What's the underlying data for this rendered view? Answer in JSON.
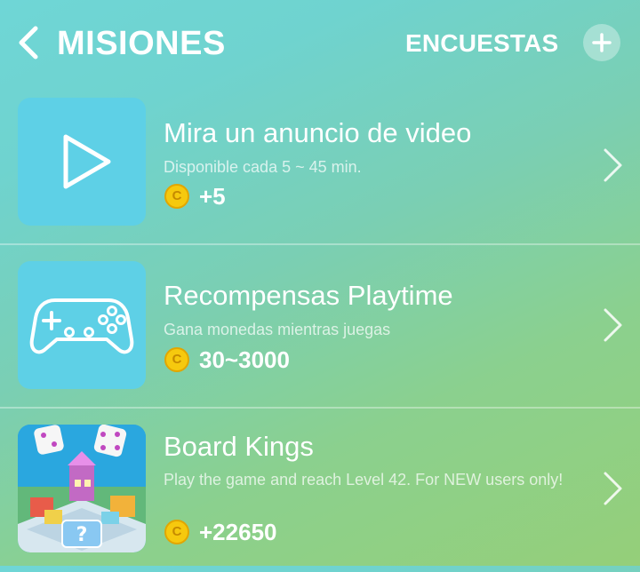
{
  "header": {
    "title": "MISIONES",
    "surveys_label": "ENCUESTAS",
    "back_icon": "chevron-left-icon",
    "add_icon": "plus-icon"
  },
  "missions": [
    {
      "title": "Mira un anuncio de video",
      "description": "Disponible cada 5 ~ 45 min.",
      "reward": "+5",
      "coin_symbol": "C",
      "icon": "play-icon"
    },
    {
      "title": "Recompensas Playtime",
      "description": "Gana monedas mientras juegas",
      "reward": "30~3000",
      "coin_symbol": "C",
      "icon": "gamepad-icon"
    },
    {
      "title": "Board Kings",
      "description": "Play the game and reach Level 42. For NEW users only!",
      "reward": "+22650",
      "coin_symbol": "C",
      "icon": "board-kings-app-icon"
    }
  ],
  "colors": {
    "tile": "#5ed0e6",
    "coin": "#f6c90e",
    "text": "#ffffff"
  }
}
